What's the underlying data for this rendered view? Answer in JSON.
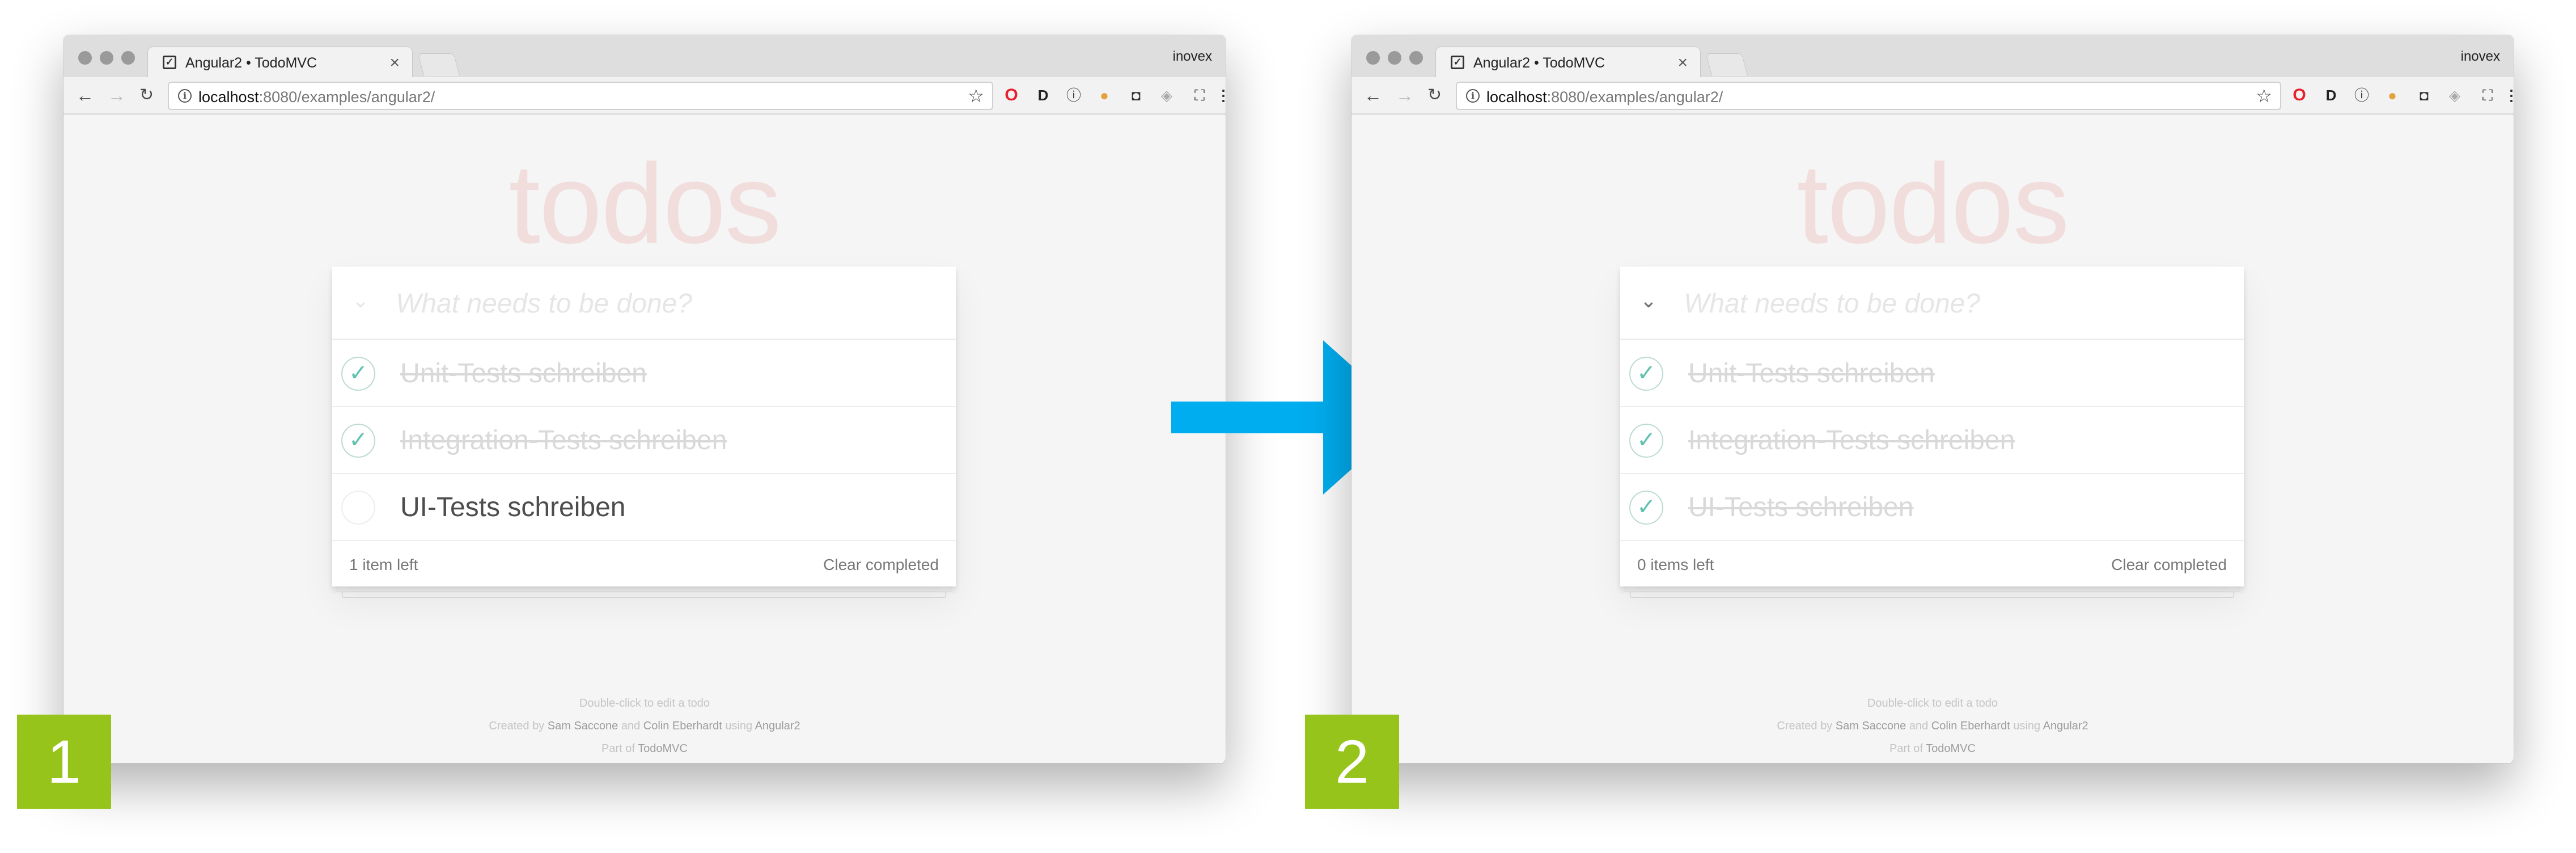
{
  "browser": {
    "tab_title": "Angular2 • TodoMVC",
    "tab_close": "×",
    "profile_name": "inovex",
    "url_host": "localhost",
    "url_rest": ":8080/examples/angular2/",
    "nav_back": "←",
    "nav_forward": "→",
    "nav_reload": "↻",
    "star": "☆",
    "extensions": [
      "opera-icon",
      "d-icon",
      "info-icon",
      "cookie-icon",
      "pocket-icon",
      "shield-icon",
      "fullscreen-icon",
      "menu-dots-icon"
    ]
  },
  "app": {
    "heading": "todos",
    "new_todo_placeholder": "What needs to be done?",
    "toggle_glyph": "⌄",
    "check_glyph": "✓",
    "clear_completed": "Clear completed",
    "info_line1": "Double-click to edit a todo",
    "info_created_by": "Created by",
    "info_author1": "Sam Saccone",
    "info_and": "and",
    "info_author2": "Colin Eberhardt",
    "info_using": "using",
    "info_framework": "Angular2",
    "info_part_of": "Part of",
    "info_todomvc": "TodoMVC"
  },
  "panels": [
    {
      "step": "1",
      "toggle_all_active": false,
      "items": [
        {
          "label": "Unit-Tests schreiben",
          "completed": true
        },
        {
          "label": "Integration-Tests schreiben",
          "completed": true
        },
        {
          "label": "UI-Tests schreiben",
          "completed": false
        }
      ],
      "count_text": "1 item left"
    },
    {
      "step": "2",
      "toggle_all_active": true,
      "items": [
        {
          "label": "Unit-Tests schreiben",
          "completed": true
        },
        {
          "label": "Integration-Tests schreiben",
          "completed": true
        },
        {
          "label": "UI-Tests schreiben",
          "completed": true
        }
      ],
      "count_text": "0 items left"
    }
  ],
  "colors": {
    "arrow": "#00adef",
    "badge": "#97c41b",
    "check": "#5dc2af",
    "heading": "#f2dddd"
  }
}
